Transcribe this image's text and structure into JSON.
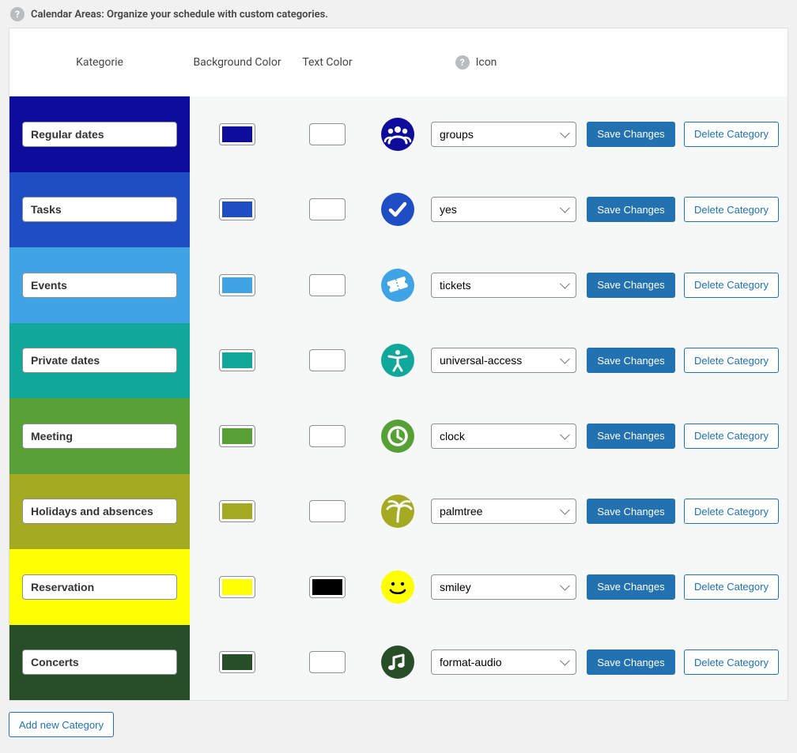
{
  "header": {
    "title": "Calendar Areas: Organize your schedule with custom categories."
  },
  "columns": {
    "name": "Kategorie",
    "bg": "Background Color",
    "text": "Text Color",
    "icon": "Icon"
  },
  "buttons": {
    "save": "Save Changes",
    "delete": "Delete Category",
    "add": "Add new Category"
  },
  "rows": [
    {
      "name": "Regular dates",
      "bg": "#0e0c9a",
      "text": "#ffffff",
      "iconColor": "#0e0c9a",
      "icon": "groups",
      "iconSvg": "groups"
    },
    {
      "name": "Tasks",
      "bg": "#1f4dc4",
      "text": "#ffffff",
      "iconColor": "#1f4dc4",
      "icon": "yes",
      "iconSvg": "yes"
    },
    {
      "name": "Events",
      "bg": "#40a3e4",
      "text": "#ffffff",
      "iconColor": "#40a3e4",
      "icon": "tickets",
      "iconSvg": "tickets"
    },
    {
      "name": "Private dates",
      "bg": "#12a79b",
      "text": "#ffffff",
      "iconColor": "#12a79b",
      "icon": "universal-access",
      "iconSvg": "universal-access"
    },
    {
      "name": "Meeting",
      "bg": "#56a036",
      "text": "#ffffff",
      "iconColor": "#56a036",
      "icon": "clock",
      "iconSvg": "clock"
    },
    {
      "name": "Holidays and absences",
      "bg": "#a4aa22",
      "text": "#ffffff",
      "iconColor": "#a4aa22",
      "icon": "palmtree",
      "iconSvg": "palmtree"
    },
    {
      "name": "Reservation",
      "bg": "#feff00",
      "text": "#000000",
      "iconColor": "#feff00",
      "icon": "smiley",
      "iconSvg": "smiley"
    },
    {
      "name": "Concerts",
      "bg": "#284e28",
      "text": "#ffffff",
      "iconColor": "#284e28",
      "icon": "format-audio",
      "iconSvg": "format-audio"
    }
  ]
}
